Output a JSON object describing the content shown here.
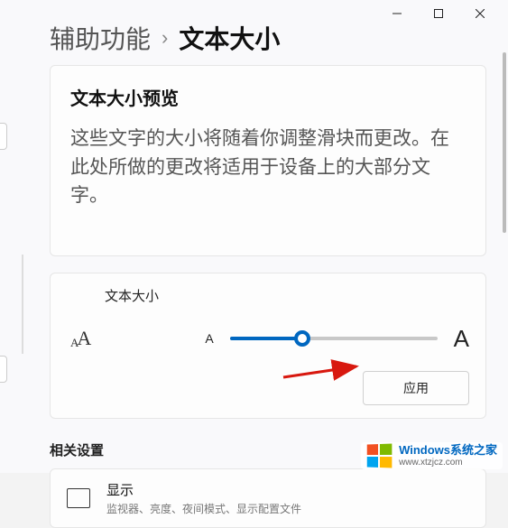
{
  "breadcrumb": {
    "parent": "辅助功能",
    "current": "文本大小"
  },
  "preview": {
    "title": "文本大小预览",
    "body": "这些文字的大小将随着你调整滑块而更改。在此处所做的更改将适用于设备上的大部分文字。"
  },
  "textSize": {
    "label": "文本大小",
    "smallA": "A",
    "largeA": "A",
    "sliderPercent": 35,
    "applyLabel": "应用"
  },
  "related": {
    "heading": "相关设置",
    "display": {
      "title": "显示",
      "subtitle": "监视器、亮度、夜间模式、显示配置文件"
    }
  },
  "watermark": {
    "name": "Windows系统之家",
    "url": "www.xtzjcz.com"
  }
}
